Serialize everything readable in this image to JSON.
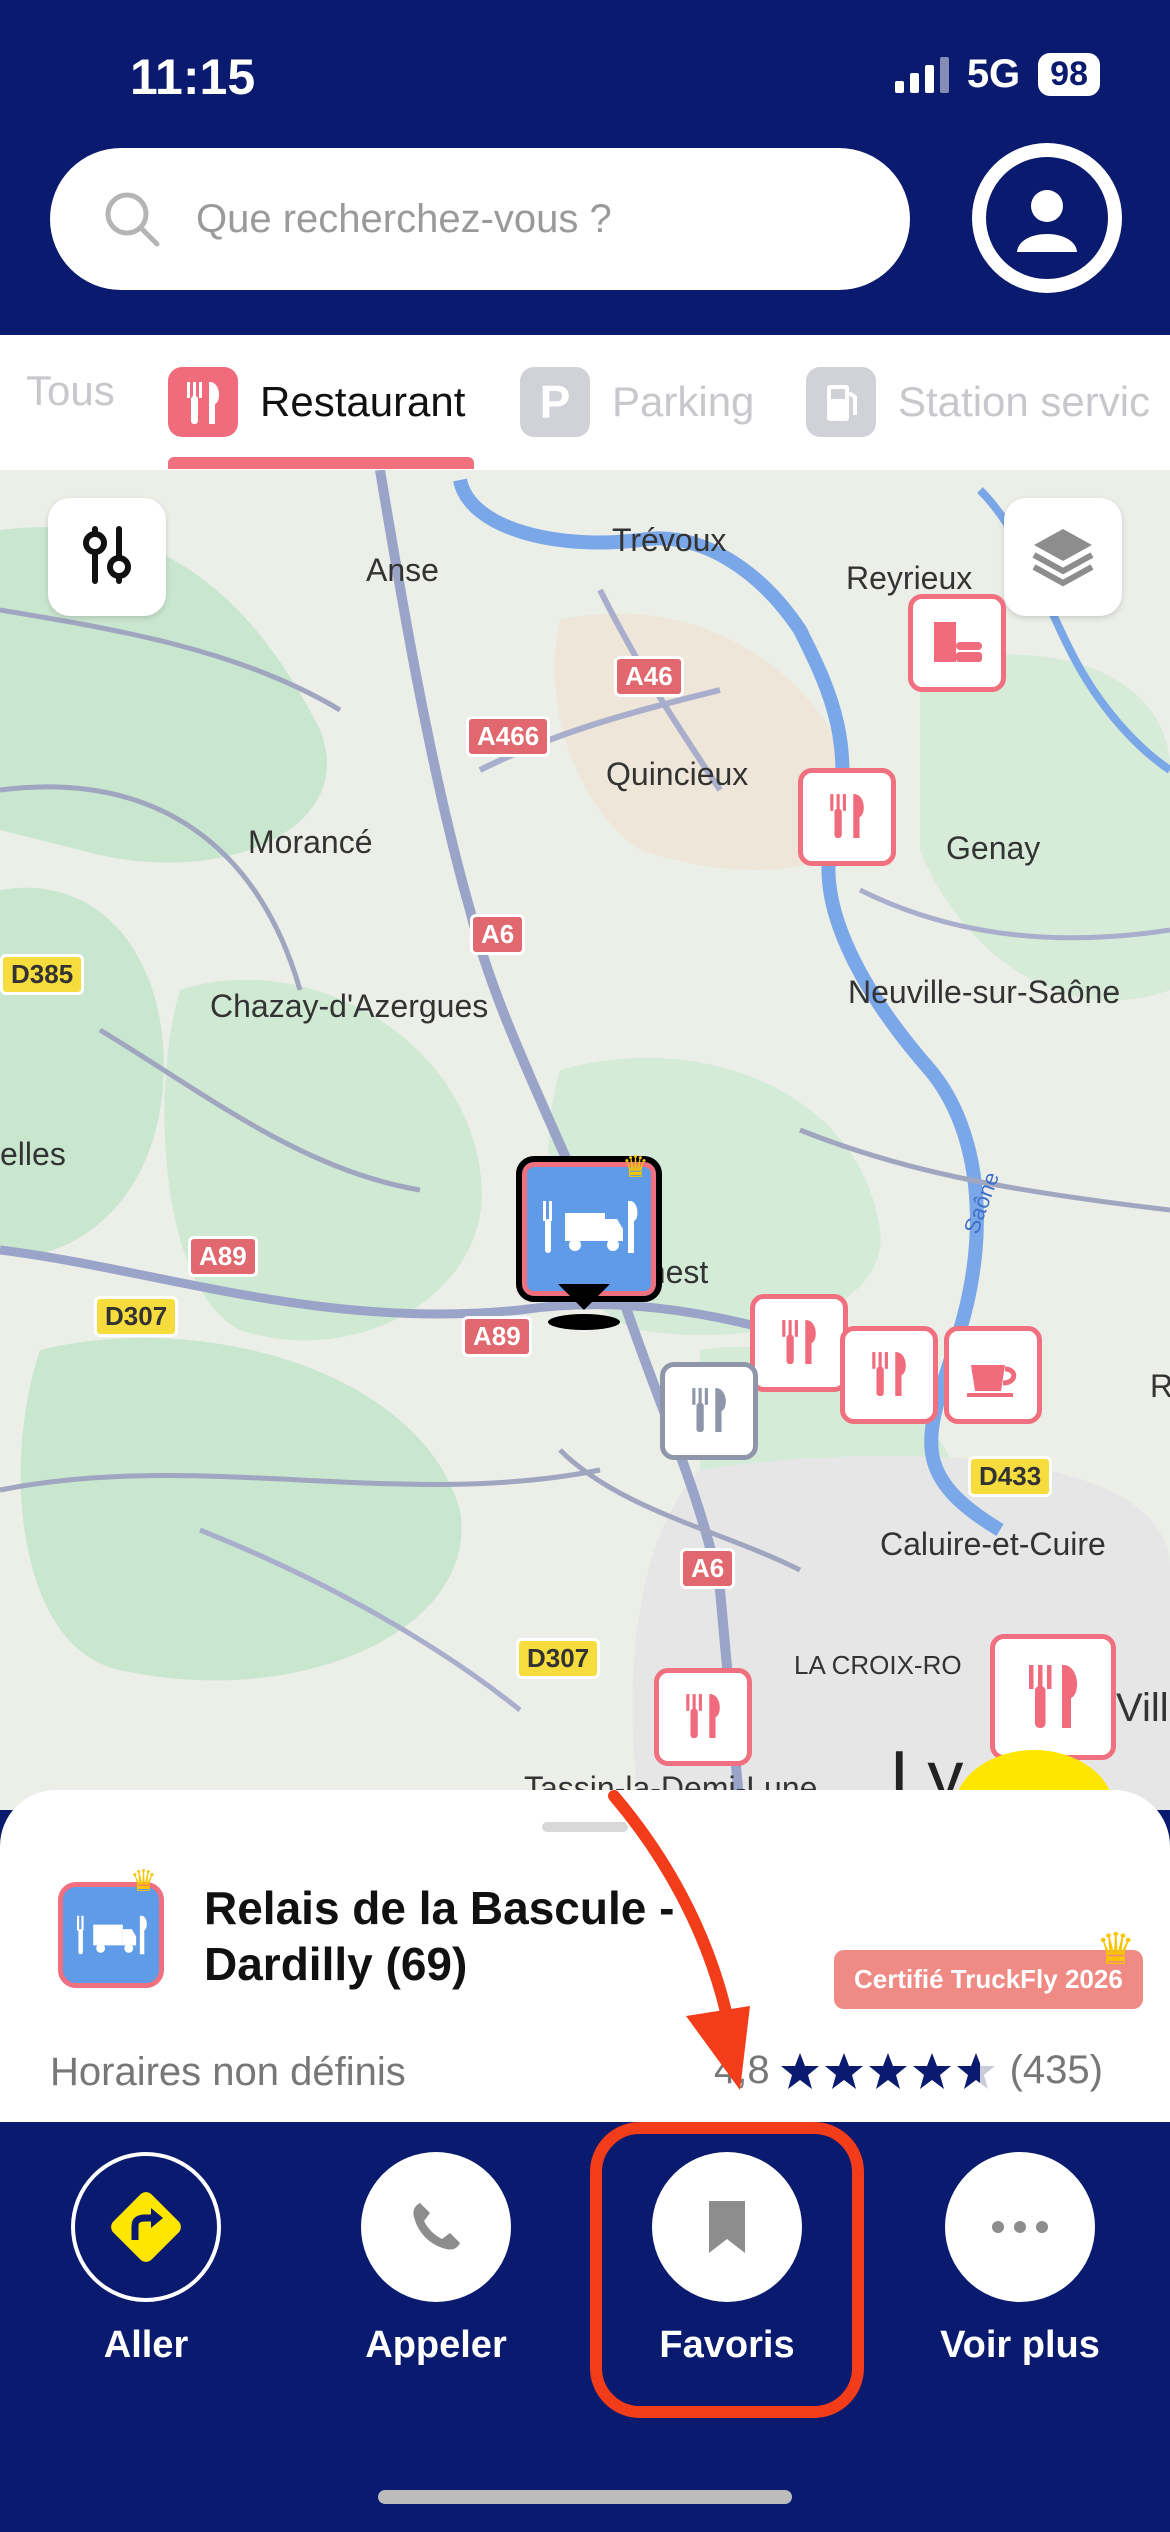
{
  "status": {
    "time": "11:15",
    "network": "5G",
    "battery": "98"
  },
  "search": {
    "placeholder": "Que recherchez-vous ?"
  },
  "tabs": [
    {
      "label": "Tous",
      "icon": "none"
    },
    {
      "label": "Restaurant",
      "icon": "fork-knife-icon",
      "active": true
    },
    {
      "label": "Parking",
      "icon": "parking-icon"
    },
    {
      "label": "Station servic",
      "icon": "fuel-pump-icon"
    }
  ],
  "map": {
    "labels": [
      "Trévoux",
      "Anse",
      "Reyrieux",
      "Quincieux",
      "Genay",
      "Morancé",
      "Chazay-d'Azergues",
      "Neuville-sur-Saône",
      "elles",
      "onest",
      "Caluire-et-Cuire",
      "LA CROIX-RO",
      "Tassin-la-Demi-Lune",
      "Saône",
      "R",
      "Vill",
      "Ly"
    ],
    "roads": [
      "A46",
      "A466",
      "A6",
      "D385",
      "A89",
      "D307",
      "A89",
      "D433",
      "A6",
      "D307"
    ]
  },
  "place": {
    "name": "Relais de la Bascule - Dardilly (69)",
    "certification": "Certifié TruckFly 2026",
    "hours": "Horaires non définis",
    "rating": "4,8",
    "reviews": "(435)"
  },
  "actions": [
    {
      "label": "Aller",
      "icon": "directions-icon"
    },
    {
      "label": "Appeler",
      "icon": "phone-icon"
    },
    {
      "label": "Favoris",
      "icon": "bookmark-icon"
    },
    {
      "label": "Voir plus",
      "icon": "more-icon"
    }
  ],
  "colors": {
    "navy": "#0a1a6e",
    "accent": "#f07080",
    "highlight": "#f23c1a",
    "yellow": "#ffe600"
  }
}
